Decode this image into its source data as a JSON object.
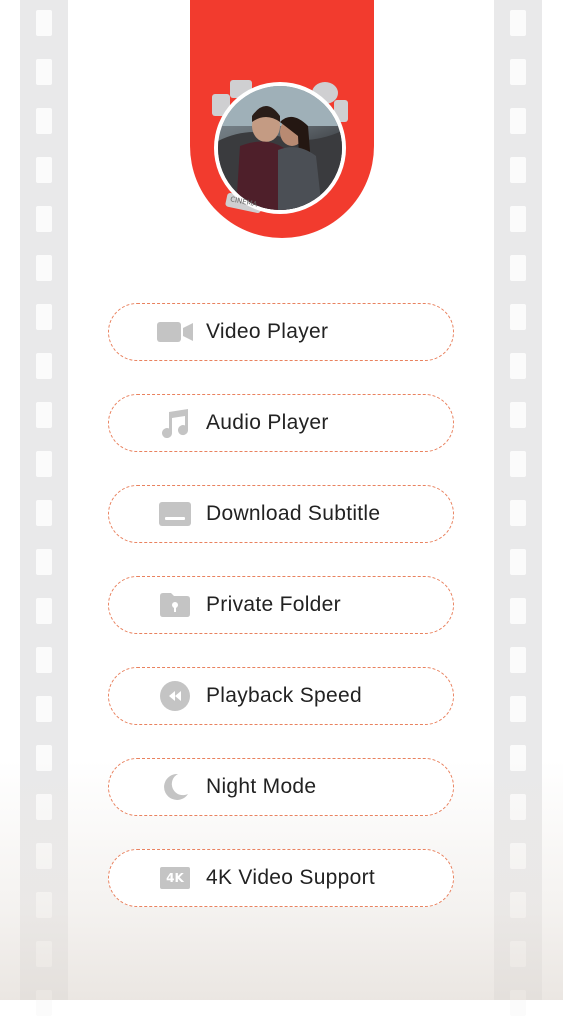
{
  "features": [
    {
      "label": "Video Player",
      "icon": "video-camera-icon"
    },
    {
      "label": "Audio Player",
      "icon": "music-note-icon"
    },
    {
      "label": "Download Subtitle",
      "icon": "subtitle-icon"
    },
    {
      "label": "Private Folder",
      "icon": "lock-folder-icon"
    },
    {
      "label": "Playback Speed",
      "icon": "rewind-icon"
    },
    {
      "label": "Night Mode",
      "icon": "moon-icon"
    },
    {
      "label": "4K Video Support",
      "icon": "4k-icon"
    }
  ],
  "badge_4k": "4K",
  "hero": {
    "decor_text": "CINEMA"
  },
  "colors": {
    "accent": "#f23b2e",
    "border": "#e9825f",
    "icon": "#c4c4c4",
    "film": "#e9e9ea"
  }
}
